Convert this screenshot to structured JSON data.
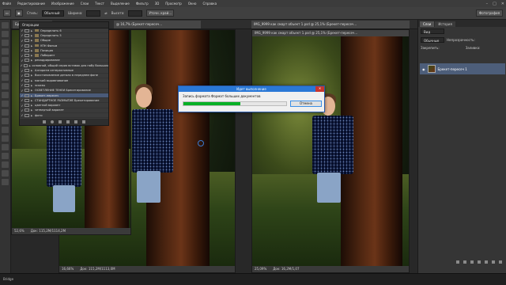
{
  "menubar": {
    "items": [
      "Файл",
      "Редактирование",
      "Изображение",
      "Слои",
      "Текст",
      "Выделение",
      "Фильтр",
      "3D",
      "Просмотр",
      "Окно",
      "Справка"
    ]
  },
  "options": {
    "style_label": "Стиль:",
    "style_value": "Обычный",
    "width_label": "Ширина:",
    "height_label": "Высота:",
    "refine_label": "Уточн. край..."
  },
  "workspace": "Фотография",
  "tabs": {
    "left_tab": "Брекет пере...",
    "mid_tab": "@ 16,7% (Брекет-пересеч...",
    "right_tab": "IMG_9999 как смарт объект 1.psd @ 25,1% (Брекет-пересеч..."
  },
  "layers_panel": {
    "title": "Операции",
    "rows": [
      {
        "label": "Определить 6",
        "folder": true,
        "selected": false
      },
      {
        "label": "Определить 5",
        "folder": true,
        "selected": false
      },
      {
        "label": "Общие",
        "folder": true,
        "selected": false
      },
      {
        "label": "УПН Фильм",
        "folder": true,
        "selected": false
      },
      {
        "label": "Позиция",
        "folder": true,
        "selected": false
      },
      {
        "label": "Лабиринт",
        "folder": true,
        "selected": false
      },
      {
        "label": "рекадрирование",
        "folder": false,
        "selected": false
      },
      {
        "label": "основной, общий серия вставок для набу больших",
        "folder": false,
        "selected": false
      },
      {
        "label": "Алгоритм интерактивные",
        "folder": false,
        "selected": false
      },
      {
        "label": "Восстановление детали в переднем фоне",
        "folder": false,
        "selected": false
      },
      {
        "label": "мягкий выравнивание",
        "folder": false,
        "selected": false
      },
      {
        "label": "эскизы",
        "folder": false,
        "selected": false
      },
      {
        "label": "ОСВЕТЛЕНИЕ ТЕНЕЙ Брекетирование",
        "folder": false,
        "selected": false
      },
      {
        "label": "Брекет-пересеч",
        "folder": false,
        "selected": true
      },
      {
        "label": "СТАНДАРТНОЕ РАЗМЫТИЕ Брекетирование",
        "folder": false,
        "selected": false
      },
      {
        "label": "цветной вариант",
        "folder": false,
        "selected": false
      },
      {
        "label": "четвертый вариант",
        "folder": false,
        "selected": false
      },
      {
        "label": "фото",
        "folder": false,
        "selected": false
      }
    ]
  },
  "docs": {
    "left_status": "Док: 115,2М/1114,2М",
    "left_zoom": "52,6%",
    "mid_status": "Док: 115,2М/1113,0М",
    "mid_zoom": "16,66%",
    "right_status": "Док: 16,2М/1,07",
    "right_zoom": "25,09%"
  },
  "dialog": {
    "title": "Идет выполнение",
    "message": "Запись формата Формат больших документов",
    "progress": 0.55,
    "cancel_label": "Отмена",
    "close_glyph": "✕"
  },
  "right_dock": {
    "tabs": [
      "Слои",
      "История"
    ],
    "kind_label": "Вид",
    "blend_mode": "Обычные",
    "opacity_label": "Непрозрачность:",
    "lock_label": "Закрепить:",
    "fill_label": "Заливка:",
    "layer_name": "Брекет-пересеч 1"
  },
  "bottom": {
    "label": "Bridge"
  },
  "colors": {
    "progress_green": "#06b025",
    "dialog_title_blue": "#2a78d6",
    "selection_blue": "#4a5a78"
  }
}
